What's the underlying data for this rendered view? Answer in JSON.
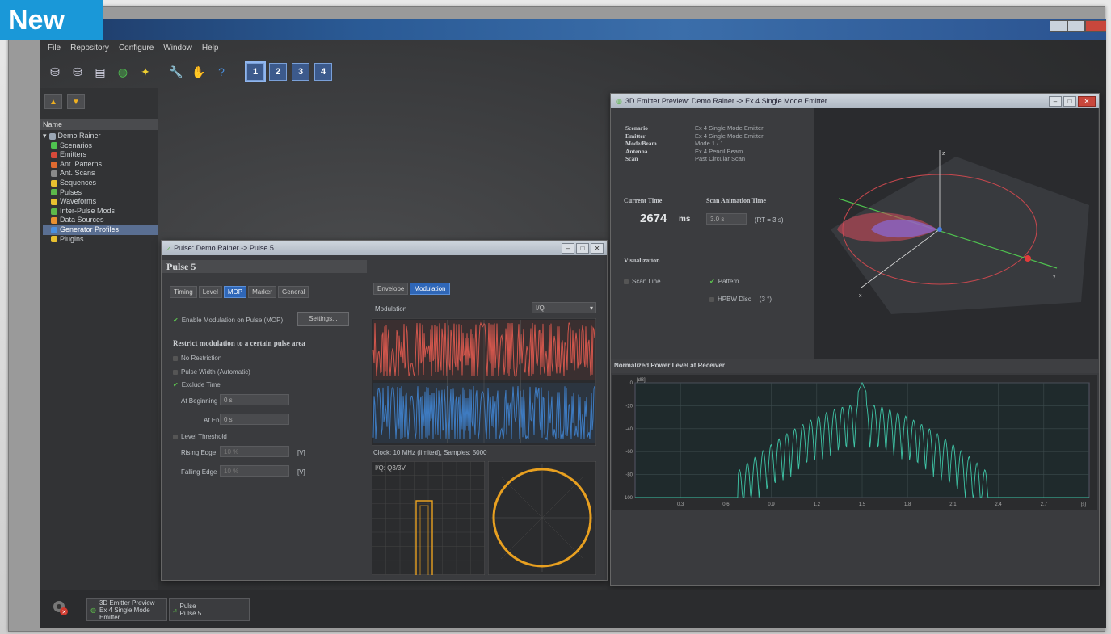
{
  "badge": {
    "label": "New"
  },
  "menu": [
    "File",
    "Repository",
    "Configure",
    "Window",
    "Help"
  ],
  "toolbar": {
    "pages": [
      "1",
      "2",
      "3",
      "4"
    ]
  },
  "sidebar": {
    "header": "Name",
    "root": "Demo Rainer",
    "items": [
      "Scenarios",
      "Emitters",
      "Ant. Patterns",
      "Ant. Scans",
      "Sequences",
      "Pulses",
      "Waveforms",
      "Inter-Pulse Mods",
      "Data Sources",
      "Generator Profiles",
      "Plugins"
    ],
    "selected": "Generator Profiles"
  },
  "taskbar": [
    {
      "line1": "3D Emitter Preview",
      "line2": "Ex 4 Single Mode Emitter"
    },
    {
      "line1": "Pulse",
      "line2": "Pulse 5"
    }
  ],
  "pulse_window": {
    "title": "Pulse: Demo Rainer -> Pulse 5",
    "heading": "Pulse 5",
    "tabs": [
      "Timing",
      "Level",
      "MOP",
      "Marker",
      "General"
    ],
    "active_tab": "MOP",
    "enable_label": "Enable Modulation on Pulse (MOP)",
    "settings_button": "Settings...",
    "restrict_heading": "Restrict modulation to a certain pulse area",
    "options": [
      "No Restriction",
      "Pulse Width (Automatic)",
      "Exclude Time"
    ],
    "at_beginning_label": "At Beginning",
    "at_beginning_value": "0 s",
    "at_end_label": "At End",
    "at_end_value": "0 s",
    "level_threshold": "Level Threshold",
    "rising_label": "Rising Edge",
    "rising_value": "10 %",
    "rising_unit": "[V]",
    "falling_label": "Falling Edge",
    "falling_value": "10 %",
    "falling_unit": "[V]",
    "right_tabs": [
      "Envelope",
      "Modulation"
    ],
    "right_active": "Modulation",
    "modulation_label": "Modulation",
    "modulation_value": "I/Q",
    "clock_text": "Clock: 10 MHz (limited), Samples: 5000",
    "scope_label": "I/Q: Q3/3V"
  },
  "emitter_window": {
    "title": "3D Emitter Preview: Demo Rainer -> Ex 4 Single Mode Emitter",
    "info": [
      {
        "k": "Scenario",
        "v": "Ex 4 Single Mode Emitter"
      },
      {
        "k": "Emitter",
        "v": "Ex 4 Single Mode Emitter"
      },
      {
        "k": "Mode/Beam",
        "v": "Mode 1 / 1"
      },
      {
        "k": "Antenna",
        "v": "Ex 4 Pencil Beam"
      },
      {
        "k": "Scan",
        "v": "Past Circular Scan"
      }
    ],
    "current_time_label": "Current Time",
    "current_time_value": "2674",
    "current_time_unit": "ms",
    "scan_anim_label": "Scan Animation Time",
    "scan_anim_value": "3.0 s",
    "scan_anim_hint": "(RT = 3 s)",
    "visualization_label": "Visualization",
    "vis_scan_line": "Scan Line",
    "vis_pattern": "Pattern",
    "vis_hpbw": "HPBW Disc",
    "vis_hpbw_val": "(3 °)",
    "axes": [
      "z",
      "y",
      "x"
    ]
  },
  "power_chart": {
    "title": "Normalized Power Level at Receiver",
    "ylabel": "[dB]",
    "xlabel_unit": "[s]"
  },
  "chart_data": {
    "type": "line",
    "title": "Normalized Power Level at Receiver",
    "ylabel": "[dB]",
    "xlabel": "[s]",
    "x_ticks": [
      "0.3",
      "0.6",
      "0.9",
      "1.2",
      "1.5",
      "1.8",
      "2.1",
      "2.4",
      "2.7"
    ],
    "y_ticks": [
      "0",
      "-20",
      "-40",
      "-60",
      "-80",
      "-100"
    ],
    "ylim": [
      -100,
      0
    ],
    "xlim": [
      0,
      3
    ],
    "series": [
      {
        "peak_x": 1.5,
        "peak_y": 0,
        "floor": -100,
        "lobe_start": 0.68,
        "lobe_end": 2.33
      }
    ]
  },
  "colors": {
    "accent": "#2f67b8",
    "trace_i": "#d9584e",
    "trace_q": "#3f7fc8",
    "power": "#3fc7a8",
    "scope": "#e8a020"
  }
}
